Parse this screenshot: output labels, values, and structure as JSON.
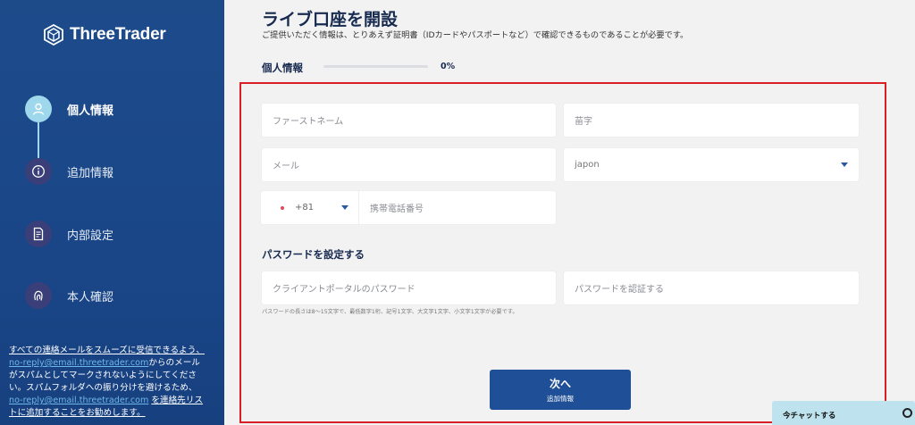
{
  "colors": {
    "sidebar_bg": "#1d4b8a",
    "accent": "#1f4f96",
    "active_step": "#9fd8ec",
    "frame_highlight": "#d91e26",
    "chat_bg": "#bfe3ee"
  },
  "brand": {
    "name": "ThreeTrader",
    "logo_icon": "cube-logo-icon"
  },
  "sidebar": {
    "steps": [
      {
        "label": "個人情報",
        "icon": "user-icon",
        "active": true
      },
      {
        "label": "追加情報",
        "icon": "info-icon",
        "active": false
      },
      {
        "label": "内部設定",
        "icon": "document-icon",
        "active": false
      },
      {
        "label": "本人確認",
        "icon": "fingerprint-icon",
        "active": false
      }
    ],
    "note": {
      "part1": "すべての連絡メールをスムーズに受信できるよう、",
      "email1": "no-reply@email.threetrader.com",
      "part2": "からのメール がスパムとしてマークされないようにしてください。スパムフォルダへの振り分けを避けるため、",
      "email2": "no-reply@email.threetrader.com",
      "part3": "を連絡先リストに追加することをお勧めします。"
    }
  },
  "header": {
    "title": "ライブ口座を開設",
    "subtitle": "ご提供いただく情報は、とりあえず証明書（IDカードやパスポートなど）で確認できるものであることが必要です。"
  },
  "progress": {
    "label": "個人情報",
    "value": 0,
    "text": "0%"
  },
  "form": {
    "first_name_placeholder": "ファーストネーム",
    "last_name_placeholder": "苗字",
    "email_placeholder": "メール",
    "country_value": "japon",
    "phone_code": "+81",
    "phone_placeholder": "携帯電話番号",
    "password_section_title": "パスワードを設定する",
    "password_placeholder": "クライアントポータルのパスワード",
    "password_confirm_placeholder": "パスワードを認証する",
    "password_hint": "パスワードの長さは8〜15文字で、最低数字1桁、記号1文字、大文字1文字、小文字1文字が必要です。"
  },
  "next_button": {
    "label": "次へ",
    "sub_label": "追加情報"
  },
  "chat": {
    "label": "今チャットする",
    "icon": "chat-icon"
  }
}
